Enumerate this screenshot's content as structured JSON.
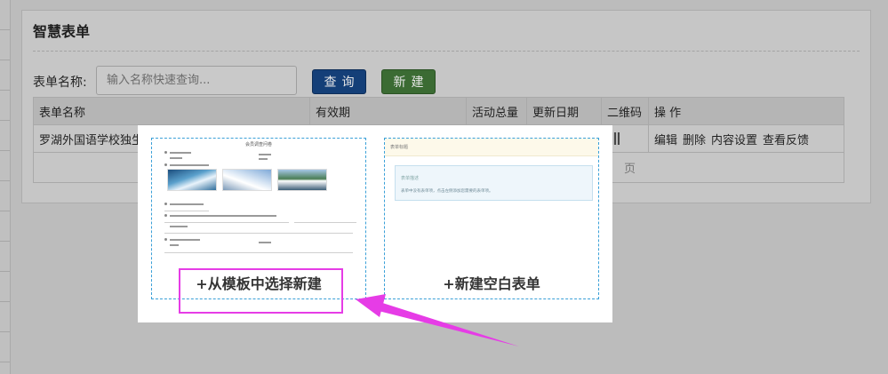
{
  "page": {
    "title": "智慧表单",
    "search_label": "表单名称:",
    "search_placeholder": "输入名称快速查询...",
    "query_button": "查询",
    "new_button": "新建"
  },
  "table": {
    "columns": [
      "表单名称",
      "有效期",
      "活动总量",
      "更新日期",
      "二维码",
      "操 作"
    ],
    "row": {
      "name": "罗湖外国语学校独生子",
      "actions": [
        "编辑",
        "删除",
        "内容设置",
        "查看反馈"
      ]
    },
    "pager": "页"
  },
  "modal": {
    "template_card": {
      "label": "+从模板中选择新建",
      "preview_title": "会员调查问卷"
    },
    "blank_card": {
      "label": "+新建空白表单",
      "preview_header": "表单标题",
      "preview_box_title": "表单描述",
      "preview_box_text": "表单中没有表单项，点击左侧添加您需要的表单项。"
    }
  },
  "colors": {
    "highlight": "#e63ce6",
    "card_border": "#3aa0d8",
    "query_button": "#143f78",
    "new_button": "#3b6b33"
  }
}
